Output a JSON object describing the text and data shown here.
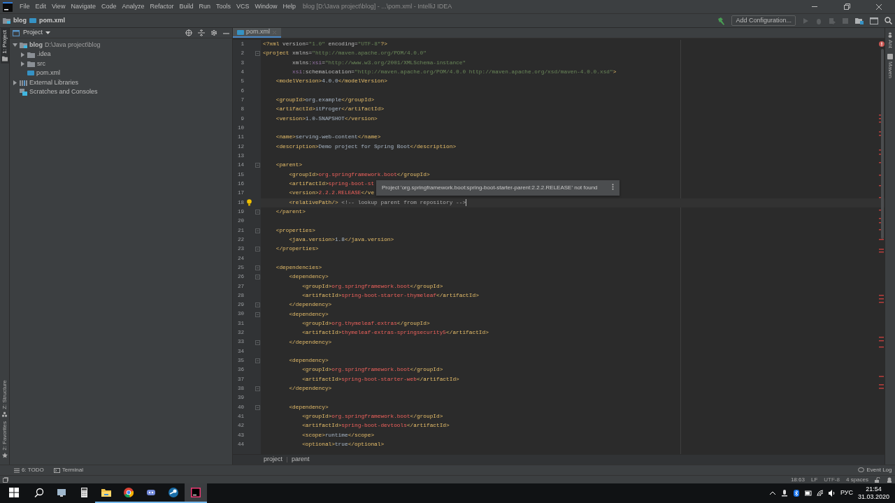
{
  "window": {
    "title": "blog [D:\\Java project\\blog] - ...\\pom.xml - IntelliJ IDEA"
  },
  "menu": [
    "File",
    "Edit",
    "View",
    "Navigate",
    "Code",
    "Analyze",
    "Refactor",
    "Build",
    "Run",
    "Tools",
    "VCS",
    "Window",
    "Help"
  ],
  "navbar": {
    "breadcrumb": [
      "blog",
      "pom.xml"
    ],
    "run_config": "Add Configuration..."
  },
  "left_stripe": [
    {
      "label": "1: Project",
      "selected": true,
      "kind": "folder"
    },
    {
      "label": "Z: Structure",
      "selected": false,
      "kind": "structure"
    },
    {
      "label": "2: Favorites",
      "selected": false,
      "kind": "star"
    }
  ],
  "right_stripe": [
    {
      "label": "Ant",
      "kind": "ant"
    },
    {
      "label": "Maven",
      "kind": "maven"
    }
  ],
  "project_panel": {
    "title": "Project",
    "tree": [
      {
        "label": "blog",
        "path": "D:\\Java project\\blog",
        "kind": "module",
        "expanded": true,
        "children": [
          {
            "label": ".idea",
            "kind": "folder",
            "expanded": false
          },
          {
            "label": "src",
            "kind": "folder",
            "expanded": false
          },
          {
            "label": "pom.xml",
            "kind": "maven"
          }
        ]
      },
      {
        "label": "External Libraries",
        "kind": "library",
        "expanded": false
      },
      {
        "label": "Scratches and Consoles",
        "kind": "scratch"
      }
    ]
  },
  "editor": {
    "tabs": [
      {
        "label": "pom.xml",
        "selected": true
      }
    ],
    "intention_bulb": true,
    "lines": [
      {
        "number": "1",
        "fold": false,
        "caret": false,
        "tokens": [
          {
            "kind": "tag",
            "text": "<?xml"
          },
          {
            "kind": "plain",
            "text": " version="
          },
          {
            "kind": "value",
            "text": "\"1.0\""
          },
          {
            "kind": "plain",
            "text": " encoding="
          },
          {
            "kind": "value",
            "text": "\"UTF-8\""
          },
          {
            "kind": "tag",
            "text": "?>"
          }
        ]
      },
      {
        "number": "2",
        "fold": true,
        "caret": false,
        "tokens": [
          {
            "kind": "tag",
            "text": "<project"
          },
          {
            "kind": "plain",
            "text": " xmlns="
          },
          {
            "kind": "value",
            "text": "\"http://maven.apache.org/POM/4.0.0\""
          }
        ]
      },
      {
        "number": "3",
        "fold": false,
        "caret": false,
        "tokens": [
          {
            "kind": "plain",
            "text": "         xmlns:"
          },
          {
            "kind": "ns",
            "text": "xsi"
          },
          {
            "kind": "plain",
            "text": "="
          },
          {
            "kind": "value",
            "text": "\"http://www.w3.org/2001/XMLSchema-instance\""
          }
        ]
      },
      {
        "number": "4",
        "fold": false,
        "caret": false,
        "tokens": [
          {
            "kind": "ns",
            "text": "         xsi"
          },
          {
            "kind": "plain",
            "text": ":schemaLocation="
          },
          {
            "kind": "value",
            "text": "\"http://maven.apache.org/POM/4.0.0 http://maven.apache.org/xsd/maven-4.0.0.xsd\""
          },
          {
            "kind": "tag",
            "text": ">"
          }
        ]
      },
      {
        "number": "5",
        "fold": false,
        "caret": false,
        "tokens": [
          {
            "kind": "tag",
            "text": "    <modelVersion>"
          },
          {
            "kind": "text",
            "text": "4.0.0"
          },
          {
            "kind": "tag",
            "text": "</modelVersion>"
          }
        ]
      },
      {
        "number": "6",
        "fold": false,
        "caret": false
      },
      {
        "number": "7",
        "fold": false,
        "caret": false,
        "tokens": [
          {
            "kind": "tag",
            "text": "    <groupId>"
          },
          {
            "kind": "text",
            "text": "org.example"
          },
          {
            "kind": "tag",
            "text": "</groupId>"
          }
        ]
      },
      {
        "number": "8",
        "fold": false,
        "caret": false,
        "tokens": [
          {
            "kind": "tag",
            "text": "    <artifactId>"
          },
          {
            "kind": "text",
            "text": "itProger"
          },
          {
            "kind": "tag",
            "text": "</artifactId>"
          }
        ]
      },
      {
        "number": "9",
        "fold": false,
        "caret": false,
        "tokens": [
          {
            "kind": "tag",
            "text": "    <version>"
          },
          {
            "kind": "text",
            "text": "1.0-SNAPSHOT"
          },
          {
            "kind": "tag",
            "text": "</version>"
          }
        ]
      },
      {
        "number": "10",
        "fold": false,
        "caret": false
      },
      {
        "number": "11",
        "fold": false,
        "caret": false,
        "tokens": [
          {
            "kind": "tag",
            "text": "    <name>"
          },
          {
            "kind": "text",
            "text": "serving-web-content"
          },
          {
            "kind": "tag",
            "text": "</name>"
          }
        ]
      },
      {
        "number": "12",
        "fold": false,
        "caret": false,
        "tokens": [
          {
            "kind": "tag",
            "text": "    <description>"
          },
          {
            "kind": "text",
            "text": "Demo project for Spring Boot"
          },
          {
            "kind": "tag",
            "text": "</description>"
          }
        ]
      },
      {
        "number": "13",
        "fold": false,
        "caret": false
      },
      {
        "number": "14",
        "fold": true,
        "caret": false,
        "tokens": [
          {
            "kind": "tag",
            "text": "    <parent>"
          }
        ]
      },
      {
        "number": "15",
        "fold": false,
        "caret": false,
        "tokens": [
          {
            "kind": "tag",
            "text": "        <groupId>"
          },
          {
            "kind": "error",
            "text": "org.springframework.boot"
          },
          {
            "kind": "tag",
            "text": "</groupId>"
          }
        ]
      },
      {
        "number": "16",
        "fold": false,
        "caret": false,
        "tokens": [
          {
            "kind": "tag",
            "text": "        <artifactId>"
          },
          {
            "kind": "error",
            "text": "spring-boot-st"
          }
        ]
      },
      {
        "number": "17",
        "fold": false,
        "caret": false,
        "tokens": [
          {
            "kind": "tag",
            "text": "        <version>"
          },
          {
            "kind": "error",
            "text": "2.2.2.RELEASE"
          },
          {
            "kind": "tag",
            "text": "</ve"
          }
        ]
      },
      {
        "number": "18",
        "fold": false,
        "caret": true,
        "tokens": [
          {
            "kind": "tag",
            "text": "        <relativePath/>"
          },
          {
            "kind": "comment",
            "text": " <!-- lookup parent from repository -->"
          }
        ]
      },
      {
        "number": "19",
        "fold": true,
        "caret": false,
        "tokens": [
          {
            "kind": "tag",
            "text": "    </parent>"
          }
        ]
      },
      {
        "number": "20",
        "fold": false,
        "caret": false
      },
      {
        "number": "21",
        "fold": true,
        "caret": false,
        "tokens": [
          {
            "kind": "tag",
            "text": "    <properties>"
          }
        ]
      },
      {
        "number": "22",
        "fold": false,
        "caret": false,
        "tokens": [
          {
            "kind": "tag",
            "text": "        <java.version>"
          },
          {
            "kind": "text",
            "text": "1.8"
          },
          {
            "kind": "tag",
            "text": "</java.version>"
          }
        ]
      },
      {
        "number": "23",
        "fold": true,
        "caret": false,
        "tokens": [
          {
            "kind": "tag",
            "text": "    </properties>"
          }
        ]
      },
      {
        "number": "24",
        "fold": false,
        "caret": false
      },
      {
        "number": "25",
        "fold": true,
        "caret": false,
        "tokens": [
          {
            "kind": "tag",
            "text": "    <dependencies>"
          }
        ]
      },
      {
        "number": "26",
        "fold": true,
        "caret": false,
        "tokens": [
          {
            "kind": "tag",
            "text": "        <dependency>"
          }
        ]
      },
      {
        "number": "27",
        "fold": false,
        "caret": false,
        "tokens": [
          {
            "kind": "tag",
            "text": "            <groupId>"
          },
          {
            "kind": "error",
            "text": "org.springframework.boot"
          },
          {
            "kind": "tag",
            "text": "</groupId>"
          }
        ]
      },
      {
        "number": "28",
        "fold": false,
        "caret": false,
        "tokens": [
          {
            "kind": "tag",
            "text": "            <artifactId>"
          },
          {
            "kind": "error",
            "text": "spring-boot-starter-thymeleaf"
          },
          {
            "kind": "tag",
            "text": "</artifactId>"
          }
        ]
      },
      {
        "number": "29",
        "fold": true,
        "caret": false,
        "tokens": [
          {
            "kind": "tag",
            "text": "        </dependency>"
          }
        ]
      },
      {
        "number": "30",
        "fold": true,
        "caret": false,
        "tokens": [
          {
            "kind": "tag",
            "text": "        <dependency>"
          }
        ]
      },
      {
        "number": "31",
        "fold": false,
        "caret": false,
        "tokens": [
          {
            "kind": "tag",
            "text": "            <groupId>"
          },
          {
            "kind": "error",
            "text": "org.thymeleaf.extras"
          },
          {
            "kind": "tag",
            "text": "</groupId>"
          }
        ]
      },
      {
        "number": "32",
        "fold": false,
        "caret": false,
        "tokens": [
          {
            "kind": "tag",
            "text": "            <artifactId>"
          },
          {
            "kind": "error",
            "text": "thymeleaf-extras-springsecurity5"
          },
          {
            "kind": "tag",
            "text": "</artifactId>"
          }
        ]
      },
      {
        "number": "33",
        "fold": true,
        "caret": false,
        "tokens": [
          {
            "kind": "tag",
            "text": "        </dependency>"
          }
        ]
      },
      {
        "number": "34",
        "fold": false,
        "caret": false
      },
      {
        "number": "35",
        "fold": true,
        "caret": false,
        "tokens": [
          {
            "kind": "tag",
            "text": "        <dependency>"
          }
        ]
      },
      {
        "number": "36",
        "fold": false,
        "caret": false,
        "tokens": [
          {
            "kind": "tag",
            "text": "            <groupId>"
          },
          {
            "kind": "error",
            "text": "org.springframework.boot"
          },
          {
            "kind": "tag",
            "text": "</groupId>"
          }
        ]
      },
      {
        "number": "37",
        "fold": false,
        "caret": false,
        "tokens": [
          {
            "kind": "tag",
            "text": "            <artifactId>"
          },
          {
            "kind": "error",
            "text": "spring-boot-starter-web"
          },
          {
            "kind": "tag",
            "text": "</artifactId>"
          }
        ]
      },
      {
        "number": "38",
        "fold": true,
        "caret": false,
        "tokens": [
          {
            "kind": "tag",
            "text": "        </dependency>"
          }
        ]
      },
      {
        "number": "39",
        "fold": false,
        "caret": false
      },
      {
        "number": "40",
        "fold": true,
        "caret": false,
        "tokens": [
          {
            "kind": "tag",
            "text": "        <dependency>"
          }
        ]
      },
      {
        "number": "41",
        "fold": false,
        "caret": false,
        "tokens": [
          {
            "kind": "tag",
            "text": "            <groupId>"
          },
          {
            "kind": "error",
            "text": "org.springframework.boot"
          },
          {
            "kind": "tag",
            "text": "</groupId>"
          }
        ]
      },
      {
        "number": "42",
        "fold": false,
        "caret": false,
        "tokens": [
          {
            "kind": "tag",
            "text": "            <artifactId>"
          },
          {
            "kind": "error",
            "text": "spring-boot-devtools"
          },
          {
            "kind": "tag",
            "text": "</artifactId>"
          }
        ]
      },
      {
        "number": "43",
        "fold": false,
        "caret": false,
        "tokens": [
          {
            "kind": "tag",
            "text": "            <scope>"
          },
          {
            "kind": "text",
            "text": "runtime"
          },
          {
            "kind": "tag",
            "text": "</scope>"
          }
        ]
      },
      {
        "number": "44",
        "fold": false,
        "caret": false,
        "tokens": [
          {
            "kind": "tag",
            "text": "            <optional>"
          },
          {
            "kind": "text",
            "text": "true"
          },
          {
            "kind": "tag",
            "text": "</optional>"
          }
        ]
      }
    ],
    "tooltip": "Project 'org.springframework.boot:spring-boot-starter-parent:2.2.2.RELEASE' not found",
    "breadcrumb": [
      "project",
      "parent"
    ]
  },
  "tool_tabs": [
    {
      "label": "6: TODO",
      "kind": "todo"
    },
    {
      "label": "Terminal",
      "kind": "terminal"
    }
  ],
  "event_log": "Event Log",
  "status_bar": {
    "position": "18:63",
    "line_separator": "LF",
    "encoding": "UTF-8",
    "indent": "4 spaces"
  },
  "taskbar": {
    "apps": [
      {
        "kind": "start",
        "running": false,
        "selected": false
      },
      {
        "kind": "search",
        "running": false,
        "selected": false
      },
      {
        "kind": "monitor",
        "running": false,
        "selected": false
      },
      {
        "kind": "calculator",
        "running": false,
        "selected": false
      },
      {
        "kind": "folder",
        "running": true,
        "selected": false
      },
      {
        "kind": "browser",
        "running": true,
        "selected": false
      },
      {
        "kind": "chat",
        "running": true,
        "selected": false
      },
      {
        "kind": "game",
        "running": true,
        "selected": false
      },
      {
        "kind": "ide",
        "running": true,
        "selected": true
      }
    ],
    "language": "РУС",
    "time": "21:54",
    "date": "31.03.2020"
  }
}
